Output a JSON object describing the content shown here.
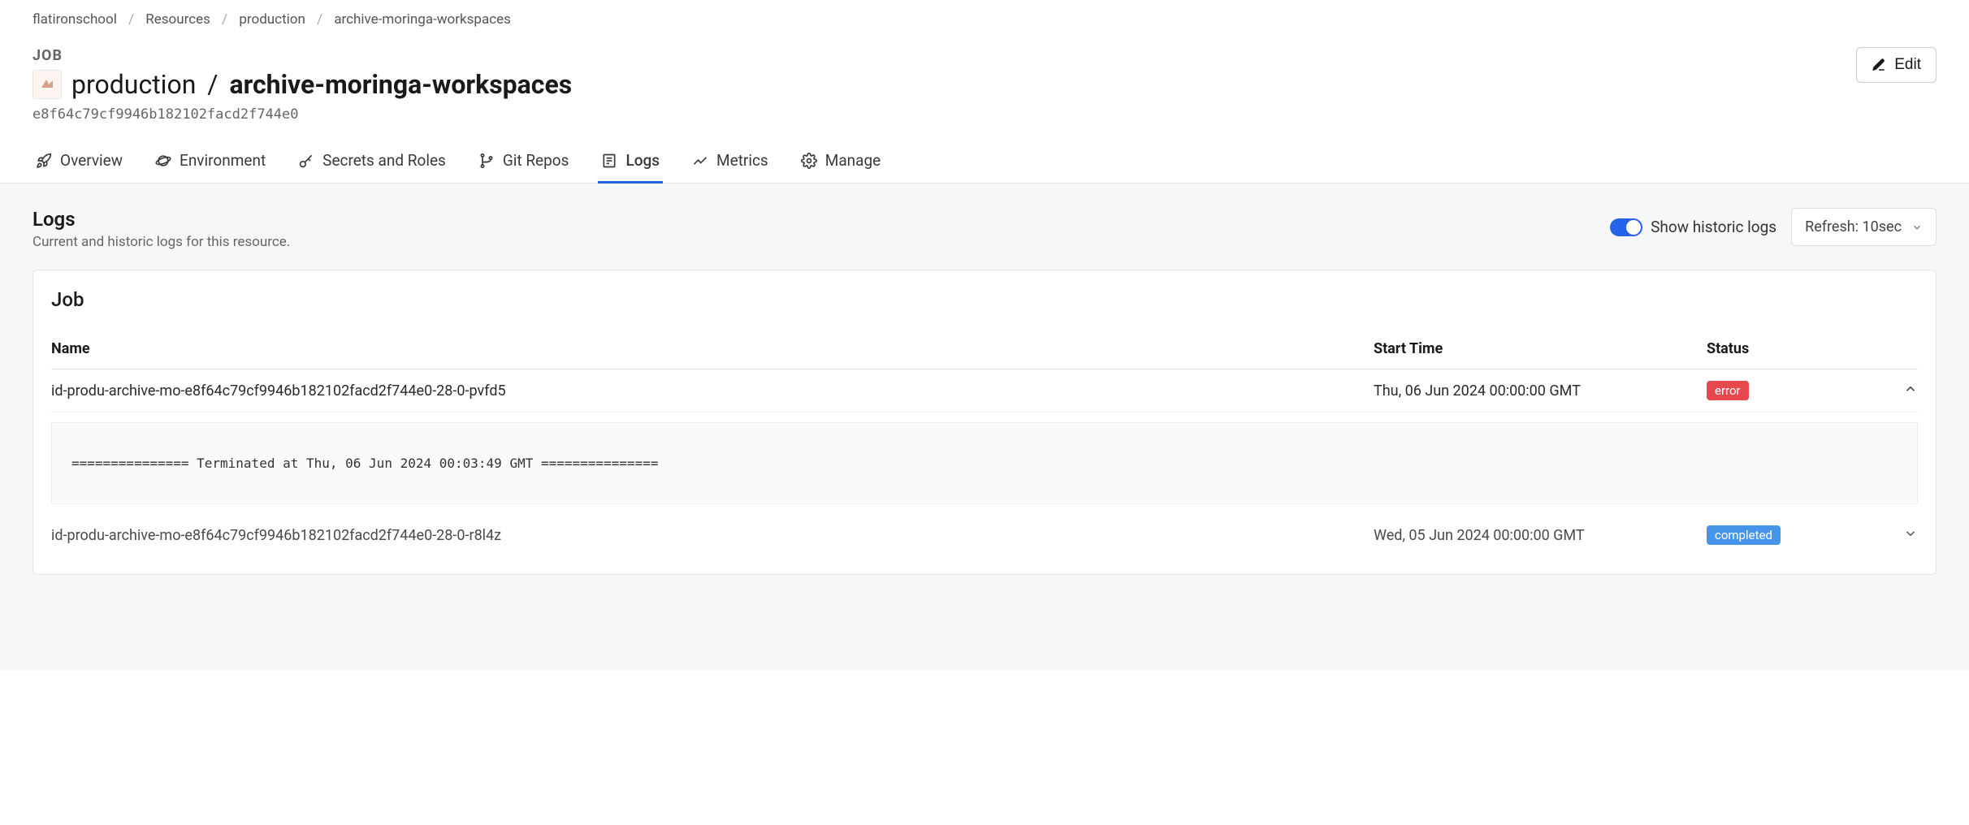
{
  "breadcrumb": {
    "items": [
      "flatironschool",
      "Resources",
      "production",
      "archive-moringa-workspaces"
    ]
  },
  "header": {
    "label": "JOB",
    "title_prefix": "production",
    "title_name": "archive-moringa-workspaces",
    "commit": "e8f64c79cf9946b182102facd2f744e0",
    "edit_label": "Edit"
  },
  "tabs": {
    "overview": "Overview",
    "environment": "Environment",
    "secrets": "Secrets and Roles",
    "gitrepos": "Git Repos",
    "logs": "Logs",
    "metrics": "Metrics",
    "manage": "Manage"
  },
  "logs": {
    "heading": "Logs",
    "subheading": "Current and historic logs for this resource.",
    "toggle_label": "Show historic logs",
    "refresh_label": "Refresh: 10sec",
    "card_title": "Job",
    "columns": {
      "name": "Name",
      "start": "Start Time",
      "status": "Status"
    },
    "rows": [
      {
        "name": "id-produ-archive-mo-e8f64c79cf9946b182102facd2f744e0-28-0-pvfd5",
        "start": "Thu, 06 Jun 2024 00:00:00 GMT",
        "status": "error",
        "status_class": "error",
        "expanded": true,
        "output": "=============== Terminated at Thu, 06 Jun 2024 00:03:49 GMT ==============="
      },
      {
        "name": "id-produ-archive-mo-e8f64c79cf9946b182102facd2f744e0-28-0-r8l4z",
        "start": "Wed, 05 Jun 2024 00:00:00 GMT",
        "status": "completed",
        "status_class": "completed",
        "expanded": false
      }
    ]
  }
}
